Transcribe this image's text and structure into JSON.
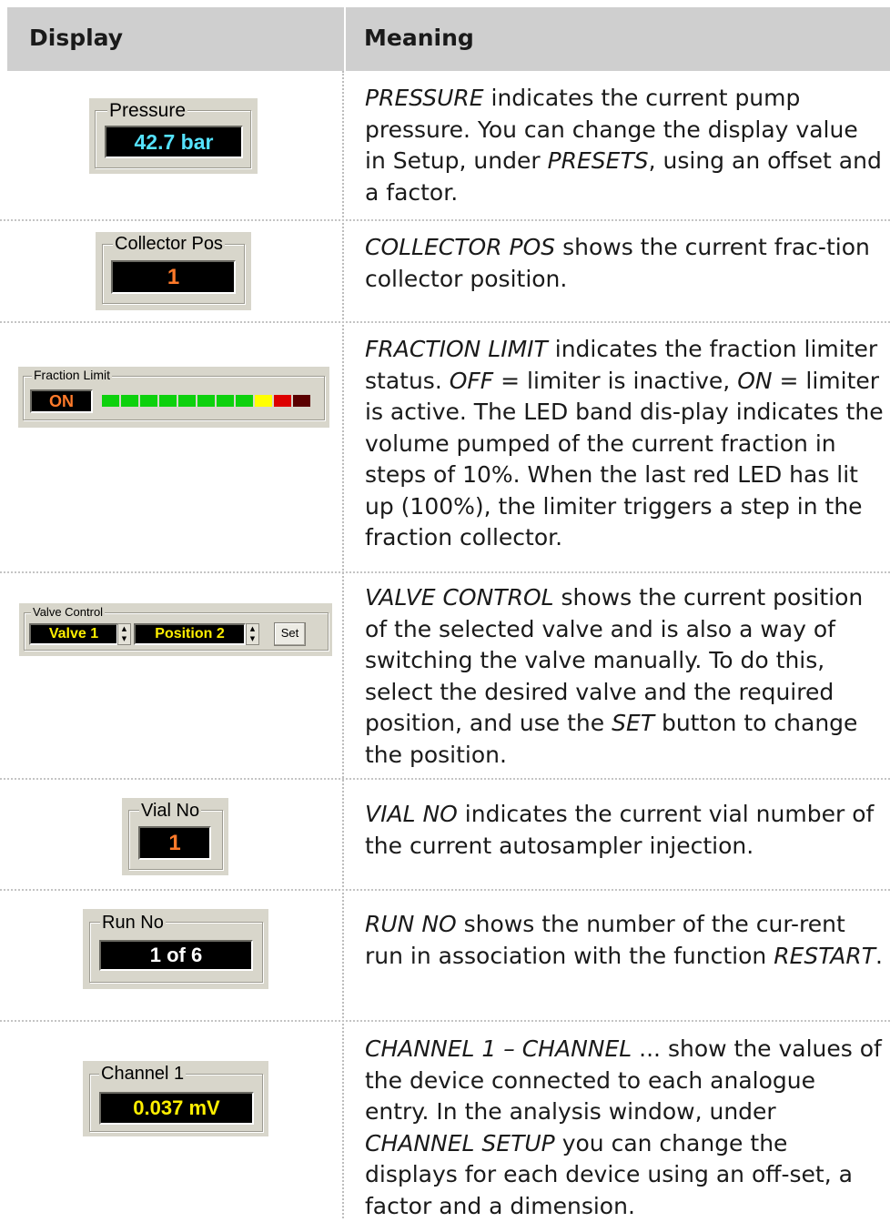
{
  "header": {
    "display": "Display",
    "meaning": "Meaning"
  },
  "colors": {
    "header_bg": "#cfcfcf",
    "panel_bg": "#d8d6cb",
    "lcd_bg": "#000000",
    "cyan": "#55e3ff",
    "orange": "#ff7a2a",
    "white": "#ffffff",
    "yellow": "#ffef00",
    "led_green": "#0dd10d",
    "led_yellow": "#ffff00",
    "led_red": "#dd0000",
    "led_darkred": "#5a0000"
  },
  "rows": [
    {
      "label": "Pressure",
      "value": "42.7 bar",
      "desc": [
        "PRESSURE",
        "  indicates the current pump pressure. You can change the display value in Setup, under ",
        "PRESETS",
        ", using an offset and a factor."
      ]
    },
    {
      "label": "Collector Pos",
      "value": "1",
      "desc": [
        "COLLECTOR POS",
        "  shows the current frac-tion collector position."
      ]
    },
    {
      "label": "Fraction Limit",
      "value": "ON",
      "leds": [
        "green",
        "green",
        "green",
        "green",
        "green",
        "green",
        "green",
        "green",
        "yellow",
        "red",
        "darkred"
      ],
      "desc": [
        "FRACTION LIMIT",
        " indicates the fraction limiter status. ",
        "OFF",
        " = limiter is inactive, ",
        "ON",
        " = limiter is active. The LED band dis-play indicates the volume pumped of the current fraction in steps of 10%. When the last red LED has lit up (100%), the limiter triggers a step in the fraction collector."
      ]
    },
    {
      "label": "Valve Control",
      "valve": "Valve 1",
      "position": "Position 2",
      "button": "Set",
      "desc": [
        "VALVE CONTROL",
        " shows the current position of the selected valve and is also a way of switching the valve manually. To do this, select the desired valve and the required position, and use the ",
        "SET",
        " button to change the position."
      ]
    },
    {
      "label": "Vial No",
      "value": "1",
      "desc": [
        "VIAL NO",
        " indicates the current vial number of the current autosampler injection."
      ]
    },
    {
      "label": "Run No",
      "value": "1 of 6",
      "desc": [
        "RUN NO",
        " shows the number of the cur-rent run in association with the function ",
        "RESTART",
        "."
      ]
    },
    {
      "label": "Channel 1",
      "value": "0.037 mV",
      "desc": [
        "CHANNEL 1 – CHANNEL",
        " ... show the values of the device connected to each analogue entry. In the analysis window, under ",
        "CHANNEL SETUP",
        " you can change the displays for each device using an off-set, a factor and a dimension."
      ]
    }
  ]
}
